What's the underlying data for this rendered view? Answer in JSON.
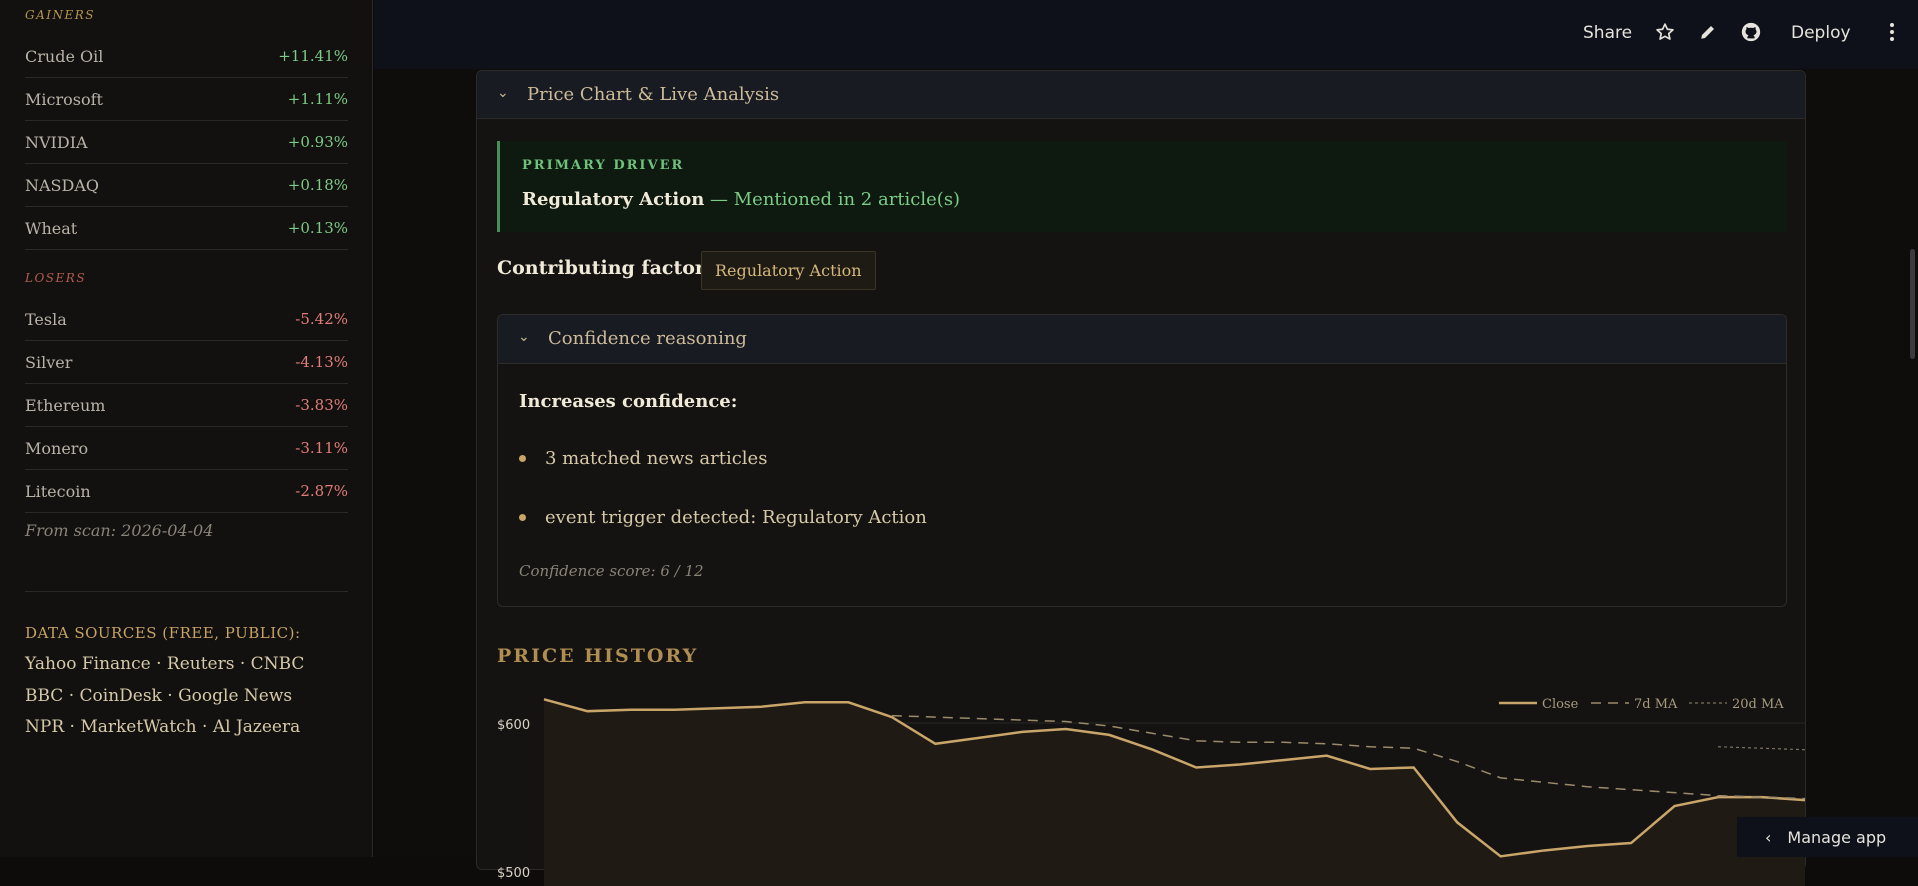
{
  "sidebar": {
    "gainers_heading": "GAINERS",
    "gainers": [
      {
        "name": "Crude Oil",
        "change": "+11.41%"
      },
      {
        "name": "Microsoft",
        "change": "+1.11%"
      },
      {
        "name": "NVIDIA",
        "change": "+0.93%"
      },
      {
        "name": "NASDAQ",
        "change": "+0.18%"
      },
      {
        "name": "Wheat",
        "change": "+0.13%"
      }
    ],
    "losers_heading": "LOSERS",
    "losers": [
      {
        "name": "Tesla",
        "change": "-5.42%"
      },
      {
        "name": "Silver",
        "change": "-4.13%"
      },
      {
        "name": "Ethereum",
        "change": "-3.83%"
      },
      {
        "name": "Monero",
        "change": "-3.11%"
      },
      {
        "name": "Litecoin",
        "change": "-2.87%"
      }
    ],
    "from_scan": "From scan: 2026-04-04",
    "sources_heading": "DATA SOURCES (FREE, PUBLIC):",
    "sources_lines": [
      "Yahoo Finance · Reuters · CNBC",
      "BBC · CoinDesk · Google News",
      "NPR · MarketWatch · Al Jazeera"
    ]
  },
  "toolbar": {
    "share": "Share",
    "deploy": "Deploy",
    "icons": [
      "star-icon",
      "pencil-icon",
      "github-icon",
      "kebab-menu-icon"
    ]
  },
  "panel": {
    "title": "Price Chart & Live Analysis",
    "primary_driver_label": "PRIMARY DRIVER",
    "primary_driver_name": "Regulatory Action",
    "primary_driver_detail": " — Mentioned in 2 article(s)",
    "contributing_label": "Contributing factors:",
    "contributing_tags": [
      "Regulatory Action"
    ],
    "confidence": {
      "title": "Confidence reasoning",
      "increases_label": "Increases confidence:",
      "bullets": [
        "3 matched news articles",
        "event trigger detected: Regulatory Action"
      ],
      "score": "Confidence score: 6 / 12"
    },
    "price_history_title": "PRICE HISTORY"
  },
  "colors": {
    "accent_gold": "#c9a56a",
    "gain_green": "#7ccb86",
    "loss_red": "#e07d78",
    "background": "#0e0d0c"
  },
  "chart_data": {
    "type": "line",
    "legend": [
      "Close",
      "7d MA",
      "20d MA"
    ],
    "legend_position": "top-right",
    "y_ticks": [
      "$600",
      "$500"
    ],
    "grid": true,
    "series": [
      {
        "name": "Close",
        "values": [
          616,
          608,
          609,
          609,
          610,
          611,
          614,
          614,
          604,
          586,
          590,
          594,
          596,
          592,
          582,
          570,
          572,
          575,
          578,
          569,
          570,
          533,
          510,
          514,
          517,
          519,
          544,
          550,
          550,
          548
        ]
      },
      {
        "name": "7d MA",
        "values": [
          null,
          null,
          null,
          null,
          null,
          null,
          null,
          null,
          605,
          604,
          603,
          602,
          601,
          598,
          593,
          588,
          587,
          587,
          586,
          584,
          583,
          574,
          563,
          560,
          557,
          555,
          553,
          551,
          550,
          549
        ]
      },
      {
        "name": "20d MA",
        "values": [
          null,
          null,
          null,
          null,
          null,
          null,
          null,
          null,
          null,
          null,
          null,
          null,
          null,
          null,
          null,
          null,
          null,
          null,
          null,
          null,
          null,
          null,
          null,
          null,
          null,
          null,
          null,
          584,
          583,
          582
        ]
      }
    ],
    "ylim": [
      490,
      625
    ]
  },
  "manage_app": "Manage app"
}
